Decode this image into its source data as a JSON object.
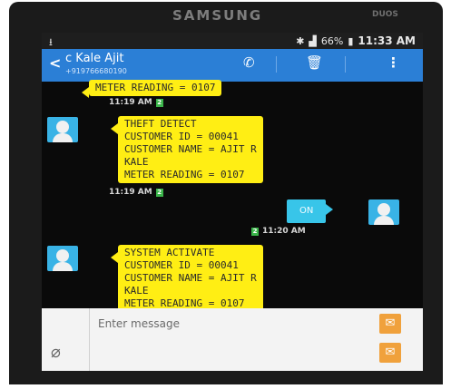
{
  "device": {
    "brand": "SAMSUNG",
    "model_badge": "DUOS"
  },
  "status_bar": {
    "usb_glyph": "⭳",
    "battery": "66%",
    "time": "11:33 AM"
  },
  "app_bar": {
    "contact_name": "c Kale Ajit",
    "contact_number": "+919766680190",
    "icons": [
      "back-arrow-icon",
      "phone-icon",
      "delete-icon",
      "overflow-menu-icon"
    ]
  },
  "messages": [
    {
      "direction": "in",
      "text": "METER READING = 0107",
      "time": "11:19 AM"
    },
    {
      "direction": "in",
      "text": "THEFT DETECT\nCUSTOMER ID = 00041\nCUSTOMER NAME = AJIT R\nKALE\nMETER READING = 0107",
      "time": "11:19 AM"
    },
    {
      "direction": "out",
      "text": "ON",
      "time": "11:20 AM"
    },
    {
      "direction": "in",
      "text": "SYSTEM ACTIVATE\nCUSTOMER ID = 00041\nCUSTOMER NAME = AJIT R\nKALE\nMETER READING = 0107",
      "time": ""
    }
  ],
  "composer": {
    "placeholder": "Enter message"
  },
  "colors": {
    "app_bar": "#2b7fd6",
    "incoming_bubble": "#ffee14",
    "outgoing_bubble": "#38c5e9",
    "send_button": "#f0a13c"
  }
}
